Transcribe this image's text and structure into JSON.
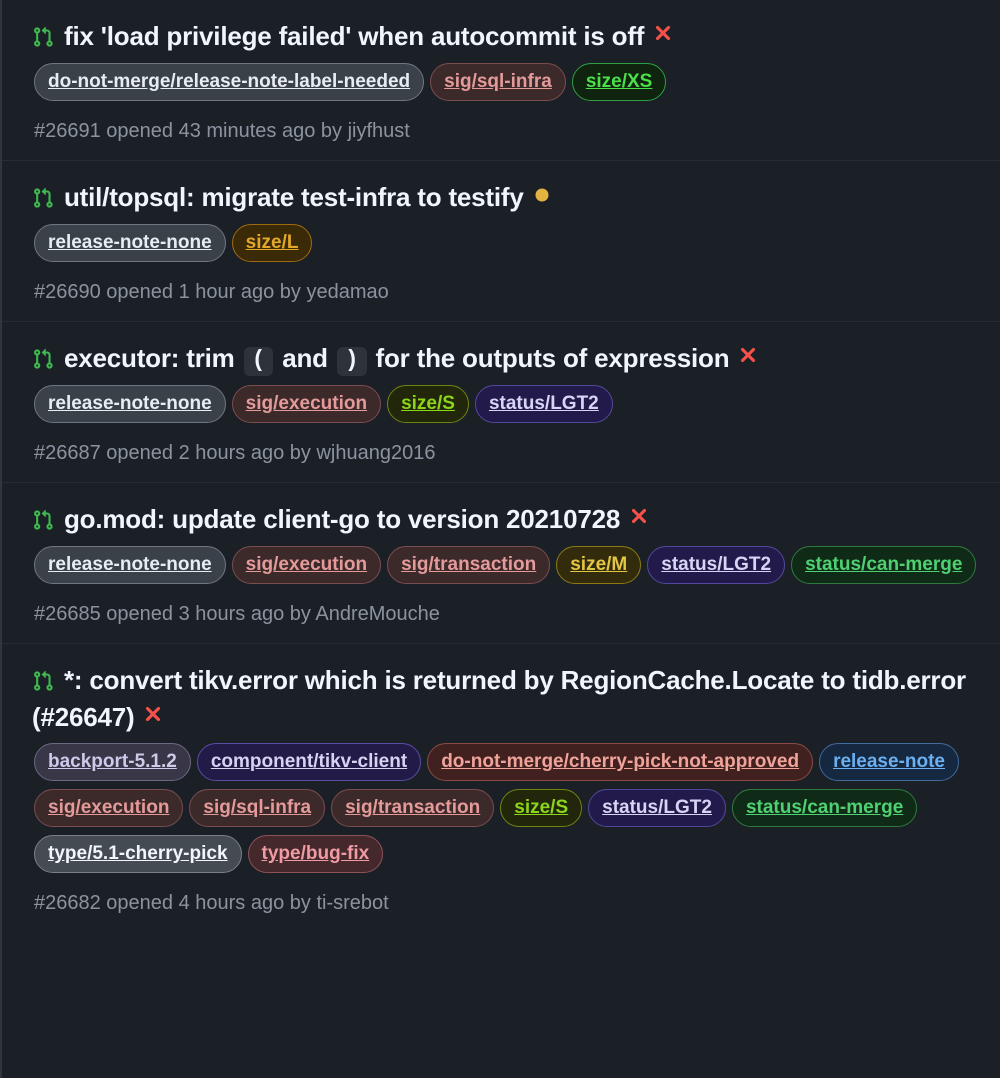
{
  "colors": {
    "page_background": "#1b2027",
    "row_divider": "#262c34",
    "left_border": "#30363d",
    "title_text": "#f0f6fc",
    "meta_text": "#8b949e",
    "status_failure": "#f85149",
    "status_pending": "#e3b341",
    "pr_icon_green": "#3fb950"
  },
  "icons": {
    "pull_request": "git-pull-request-icon",
    "failure": "x-icon",
    "pending": "dot-fill-icon"
  },
  "pull_requests": [
    {
      "icon": "git-pull-request-icon",
      "title_parts": [
        {
          "type": "text",
          "text": "fix 'load privilege failed' when autocommit is off"
        }
      ],
      "title_plain": "fix 'load privilege failed' when autocommit is off",
      "status": "failure",
      "labels": [
        {
          "name": "do-not-merge/release-note-label-needed",
          "bg": "#3b4149",
          "border": "#6e7681",
          "fg": "#e6edf3"
        },
        {
          "name": "sig/sql-infra",
          "bg": "#3c2a2b",
          "border": "#7a4d4f",
          "fg": "#e59a9a"
        },
        {
          "name": "size/XS",
          "bg": "#10230f",
          "border": "#2ea043",
          "fg": "#4ae04a"
        }
      ],
      "meta": "#26691 opened 43 minutes ago by jiyfhust",
      "number": "#26691",
      "opened": "opened 43 minutes ago",
      "author": "jiyfhust"
    },
    {
      "icon": "git-pull-request-icon",
      "title_parts": [
        {
          "type": "text",
          "text": "util/topsql: migrate test-infra to testify"
        }
      ],
      "title_plain": "util/topsql: migrate test-infra to testify",
      "status": "pending",
      "labels": [
        {
          "name": "release-note-none",
          "bg": "#3b4149",
          "border": "#6e7681",
          "fg": "#e6edf3"
        },
        {
          "name": "size/L",
          "bg": "#3b2a08",
          "border": "#9e6a10",
          "fg": "#e3a72c"
        }
      ],
      "meta": "#26690 opened 1 hour ago by yedamao",
      "number": "#26690",
      "opened": "opened 1 hour ago",
      "author": "yedamao"
    },
    {
      "icon": "git-pull-request-icon",
      "title_parts": [
        {
          "type": "text",
          "text": "executor: trim "
        },
        {
          "type": "code",
          "text": "("
        },
        {
          "type": "text",
          "text": " and "
        },
        {
          "type": "code",
          "text": ")"
        },
        {
          "type": "text",
          "text": " for the outputs of expression"
        }
      ],
      "title_plain": "executor: trim ( and ) for the outputs of expression",
      "status": "failure",
      "labels": [
        {
          "name": "release-note-none",
          "bg": "#3b4149",
          "border": "#6e7681",
          "fg": "#e6edf3"
        },
        {
          "name": "sig/execution",
          "bg": "#3c2a2b",
          "border": "#7a4d4f",
          "fg": "#e59a9a"
        },
        {
          "name": "size/S",
          "bg": "#22260a",
          "border": "#6f8512",
          "fg": "#8bd619"
        },
        {
          "name": "status/LGT2",
          "bg": "#211a4a",
          "border": "#514a9c",
          "fg": "#d8d4f5"
        }
      ],
      "meta": "#26687 opened 2 hours ago by wjhuang2016",
      "number": "#26687",
      "opened": "opened 2 hours ago",
      "author": "wjhuang2016"
    },
    {
      "icon": "git-pull-request-icon",
      "title_parts": [
        {
          "type": "text",
          "text": "go.mod: update client-go to version 20210728"
        }
      ],
      "title_plain": "go.mod: update client-go to version 20210728",
      "status": "failure",
      "labels": [
        {
          "name": "release-note-none",
          "bg": "#3b4149",
          "border": "#6e7681",
          "fg": "#e6edf3"
        },
        {
          "name": "sig/execution",
          "bg": "#3c2a2b",
          "border": "#7a4d4f",
          "fg": "#e59a9a"
        },
        {
          "name": "sig/transaction",
          "bg": "#3c2a2b",
          "border": "#7a4d4f",
          "fg": "#e59a9a"
        },
        {
          "name": "size/M",
          "bg": "#332c0c",
          "border": "#8d7a17",
          "fg": "#e3c544"
        },
        {
          "name": "status/LGT2",
          "bg": "#211a4a",
          "border": "#514a9c",
          "fg": "#d8d4f5"
        },
        {
          "name": "status/can-merge",
          "bg": "#0f2a16",
          "border": "#2f7a40",
          "fg": "#4fd072"
        }
      ],
      "meta": "#26685 opened 3 hours ago by AndreMouche",
      "number": "#26685",
      "opened": "opened 3 hours ago",
      "author": "AndreMouche"
    },
    {
      "icon": "git-pull-request-icon",
      "title_parts": [
        {
          "type": "text",
          "text": "*: convert tikv.error which is returned by RegionCache.Locate to tidb.error (#26647)"
        }
      ],
      "title_plain": "*: convert tikv.error which is returned by RegionCache.Locate to tidb.error (#26647)",
      "status": "failure",
      "labels": [
        {
          "name": "backport-5.1.2",
          "bg": "#383647",
          "border": "#6a6882",
          "fg": "#cfc9ea"
        },
        {
          "name": "component/tikv-client",
          "bg": "#221a47",
          "border": "#574ea3",
          "fg": "#d6d2f2"
        },
        {
          "name": "do-not-merge/cherry-pick-not-approved",
          "bg": "#40211f",
          "border": "#8a4b45",
          "fg": "#f0a39a"
        },
        {
          "name": "release-note",
          "bg": "#15283f",
          "border": "#3f6b9e",
          "fg": "#6ab0f3"
        },
        {
          "name": "sig/execution",
          "bg": "#3c2a2b",
          "border": "#7a4d4f",
          "fg": "#e59a9a"
        },
        {
          "name": "sig/sql-infra",
          "bg": "#3c2a2b",
          "border": "#7a4d4f",
          "fg": "#e59a9a"
        },
        {
          "name": "sig/transaction",
          "bg": "#3c2a2b",
          "border": "#7a4d4f",
          "fg": "#e59a9a"
        },
        {
          "name": "size/S",
          "bg": "#22260a",
          "border": "#6f8512",
          "fg": "#8bd619"
        },
        {
          "name": "status/LGT2",
          "bg": "#211a4a",
          "border": "#514a9c",
          "fg": "#d8d4f5"
        },
        {
          "name": "status/can-merge",
          "bg": "#0f2a16",
          "border": "#2f7a40",
          "fg": "#4fd072"
        },
        {
          "name": "type/5.1-cherry-pick",
          "bg": "#454b52",
          "border": "#787f87",
          "fg": "#f0f6fc"
        },
        {
          "name": "type/bug-fix",
          "bg": "#44282b",
          "border": "#8c5258",
          "fg": "#f09aa3"
        }
      ],
      "meta": "#26682 opened 4 hours ago by ti-srebot",
      "number": "#26682",
      "opened": "opened 4 hours ago",
      "author": "ti-srebot"
    }
  ]
}
